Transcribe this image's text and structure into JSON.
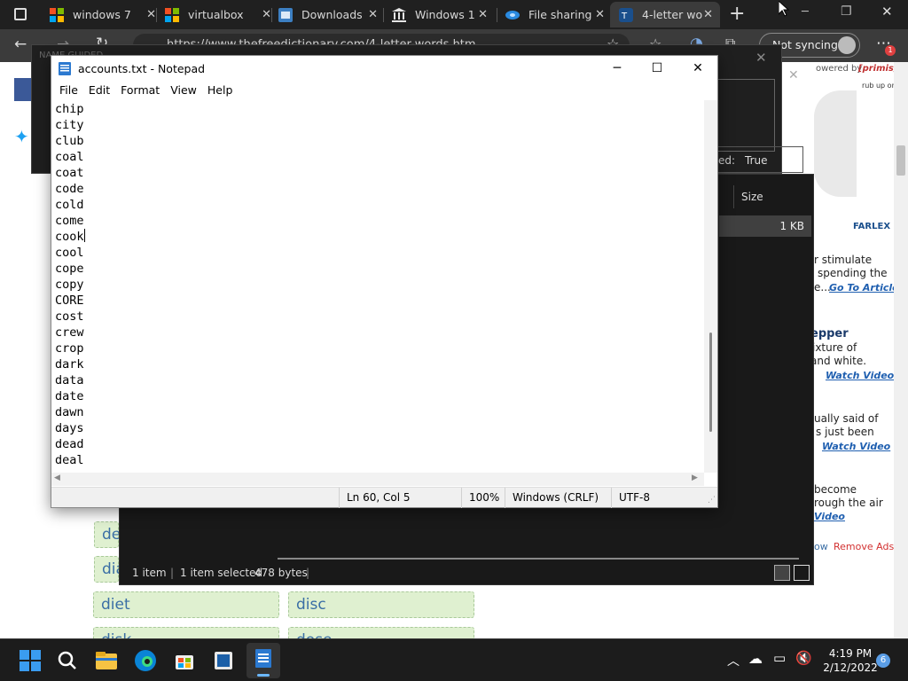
{
  "browser": {
    "tabs": [
      {
        "title": "windows 7",
        "close": "✕"
      },
      {
        "title": "virtualbox",
        "close": "✕"
      },
      {
        "title": "Downloads",
        "close": "✕"
      },
      {
        "title": "Windows 1",
        "close": "✕"
      },
      {
        "title": "File sharing",
        "close": "✕"
      },
      {
        "title": "4-letter wo",
        "close": "✕"
      }
    ],
    "url": "https://www.thefreedictionary.com/4-letter-words.htm",
    "sync_label": "Not syncing",
    "notification_count": "1",
    "new_tab": "+"
  },
  "webpage": {
    "words": [
      "de",
      "dia",
      "diet",
      "disc",
      "disk",
      "dose"
    ],
    "ad_fragments": [
      "r stimulate",
      "spending the",
      "e...",
      "epper",
      "ixture of",
      "and white.",
      "ually said of",
      "s just been",
      "become",
      "rough the air"
    ],
    "ad_links": [
      "Go To Article",
      "Watch Video",
      "Watch Video",
      "Video"
    ],
    "powered_by": "owered by",
    "primis": "[primis]",
    "rub_up_on": "rub up on",
    "farlex": "FARLEX",
    "remove_ads_prefix": "ow",
    "remove_ads": "Remove Ads"
  },
  "dark_dialog": {
    "label": "NAME GUIDED",
    "field_label": "ed:",
    "field_value": "True"
  },
  "explorer": {
    "column_size": "Size",
    "row_size": "1 KB",
    "status_items": "1 item",
    "status_selected": "1 item selected",
    "status_bytes": "478 bytes"
  },
  "notepad": {
    "title": "accounts.txt - Notepad",
    "menu": [
      "File",
      "Edit",
      "Format",
      "View",
      "Help"
    ],
    "lines": [
      "chip",
      "city",
      "club",
      "coal",
      "coat",
      "code",
      "cold",
      "come",
      "cook",
      "cool",
      "cope",
      "copy",
      "CORE",
      "cost",
      "crew",
      "crop",
      "dark",
      "data",
      "date",
      "dawn",
      "days",
      "dead",
      "deal"
    ],
    "status": {
      "position": "Ln 60, Col 5",
      "zoom": "100%",
      "line_ending": "Windows (CRLF)",
      "encoding": "UTF-8"
    },
    "minimize": "─",
    "maximize": "☐",
    "close": "✕"
  },
  "taskbar": {
    "time": "4:19 PM",
    "date": "2/12/2022",
    "notification_badge": "6"
  },
  "colors": {
    "notepad_icon": "#2b79d0",
    "edge_blue": "#0a84d6",
    "word_box_bg": "#dff0d0",
    "remove_ads": "#d23030",
    "taskbar_bg": "#1c1c1c"
  }
}
